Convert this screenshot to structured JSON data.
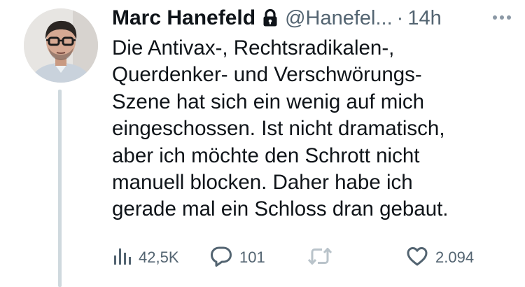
{
  "tweet": {
    "author_name": "Marc Hanefeld",
    "handle": "@Hanefel...",
    "separator": "·",
    "time": "14h",
    "body_lines": [
      "Die Antivax-, Rechtsradikalen-,",
      "Querdenker- und Verschwörungs-",
      "Szene hat sich ein wenig auf mich",
      "eingeschossen. Ist nicht dramatisch,",
      "aber ich möchte den Schrott nicht",
      "manuell blocken. Daher habe ich",
      "gerade mal ein Schloss dran gebaut."
    ],
    "stats": {
      "views": "42,5K",
      "replies": "101",
      "retweets": "",
      "likes": "2.094"
    }
  },
  "icons": {
    "lock": "lock-icon",
    "more": "more-icon",
    "views": "views-icon",
    "reply": "reply-icon",
    "retweet": "retweet-icon",
    "like": "heart-icon"
  },
  "colors": {
    "text_primary": "#0f1419",
    "text_secondary": "#536471",
    "thread_line": "#cfd9de",
    "retweet_muted": "#b9c3ca"
  }
}
